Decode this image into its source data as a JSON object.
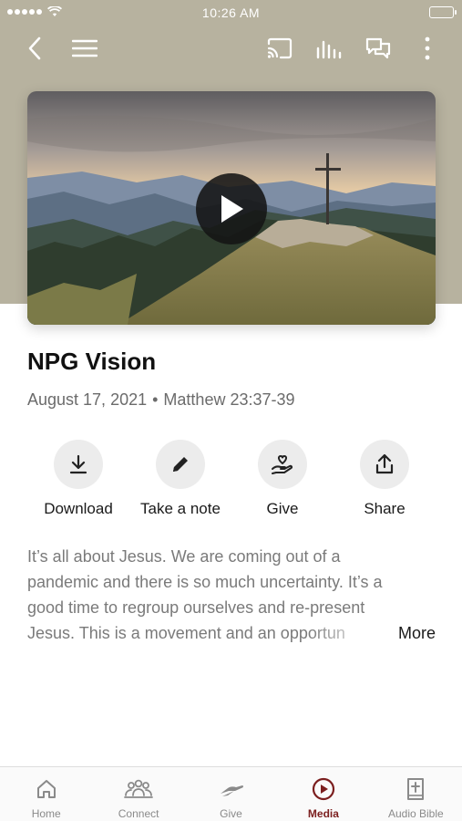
{
  "status_bar": {
    "time": "10:26 AM"
  },
  "nav": {
    "icons": [
      "back-icon",
      "menu-icon",
      "cast-icon",
      "audio-levels-icon",
      "chat-icon",
      "more-vertical-icon"
    ]
  },
  "video": {
    "play_icon": "play-icon"
  },
  "sermon": {
    "title": "NPG Vision",
    "date": "August 17, 2021",
    "separator": "•",
    "scripture": "Matthew 23:37-39"
  },
  "actions": [
    {
      "label": "Download",
      "icon": "download-icon"
    },
    {
      "label": "Take a note",
      "icon": "pencil-icon"
    },
    {
      "label": "Give",
      "icon": "heart-hand-icon"
    },
    {
      "label": "Share",
      "icon": "share-icon"
    }
  ],
  "description": {
    "lines": [
      "It’s all about Jesus. We are coming out of a",
      "pandemic and there is so much uncertainty. It’s a",
      "good time to regroup ourselves and re-present",
      "Jesus. This is a movement and an opportun"
    ],
    "more_label": "More"
  },
  "tabbar": {
    "active_color": "#7b1e1e",
    "tabs": [
      {
        "label": "Home",
        "icon": "home-icon",
        "active": false
      },
      {
        "label": "Connect",
        "icon": "people-icon",
        "active": false
      },
      {
        "label": "Give",
        "icon": "give-hand-icon",
        "active": false
      },
      {
        "label": "Media",
        "icon": "play-circle-icon",
        "active": true
      },
      {
        "label": "Audio Bible",
        "icon": "bible-icon",
        "active": false
      }
    ]
  }
}
